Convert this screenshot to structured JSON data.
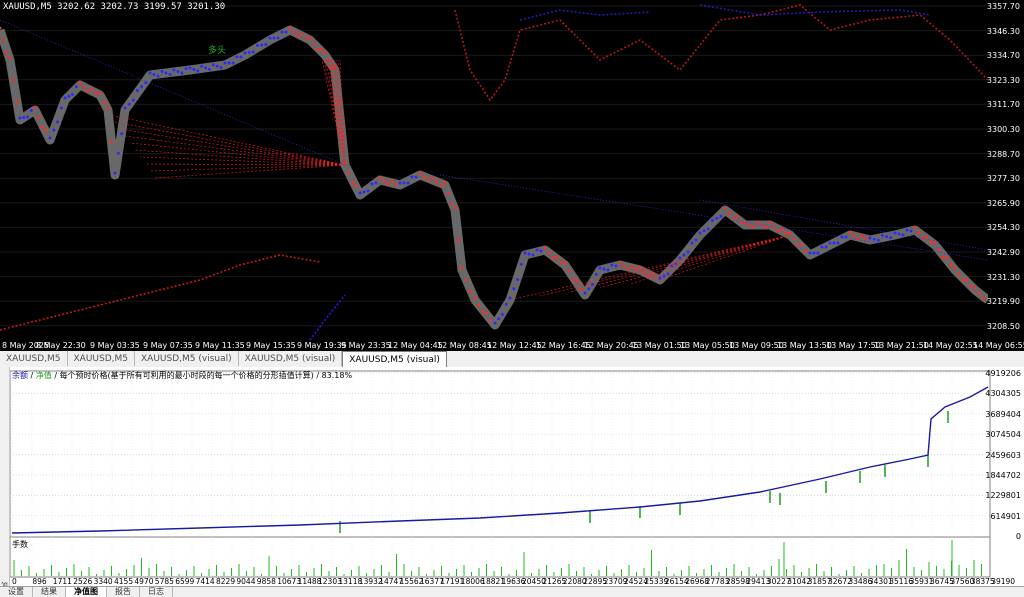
{
  "chart": {
    "symbol_label": "XAUUSD,M5  3202.62 3202.73 3199.57 3201.30",
    "annotation": "多头",
    "price_ticks": [
      "3357.70",
      "3346.30",
      "3334.70",
      "3323.30",
      "3311.70",
      "3300.30",
      "3288.70",
      "3277.30",
      "3265.90",
      "3254.30",
      "3242.90",
      "3231.30",
      "3219.90",
      "3208.50"
    ],
    "time_ticks": [
      "8 May 2025",
      "8 May 22:30",
      "9 May 03:35",
      "9 May 07:35",
      "9 May 11:35",
      "9 May 15:35",
      "9 May 19:35",
      "9 May 23:35",
      "12 May 04:45",
      "12 May 08:45",
      "12 May 12:45",
      "12 May 16:45",
      "12 May 20:45",
      "13 May 01:50",
      "13 May 05:50",
      "13 May 09:50",
      "13 May 13:50",
      "13 May 17:50",
      "13 May 21:50",
      "14 May 02:55",
      "14 May 06:55"
    ]
  },
  "tabs": [
    {
      "label": "XAUUSD,M5",
      "active": false
    },
    {
      "label": "XAUUSD,M5",
      "active": false
    },
    {
      "label": "XAUUSD,M5 (visual)",
      "active": false
    },
    {
      "label": "XAUUSD,M5 (visual)",
      "active": false
    },
    {
      "label": "XAUUSD,M5 (visual)",
      "active": true
    }
  ],
  "equity_graph": {
    "legend_balance": "余额",
    "legend_sep1": " / ",
    "legend_equity": "净值",
    "legend_sep2": " / ",
    "legend_text": "每个预时价格(基于所有可利用的最小时段的每一个价格的分形插值计算) / 83.18%",
    "y_ticks": [
      "4919206",
      "4304305",
      "3689404",
      "3074504",
      "2459603",
      "1844702",
      "1229801",
      "614901",
      "0"
    ],
    "volume_label": "手数",
    "x_ticks": [
      "0",
      "896",
      "1711",
      "2526",
      "3340",
      "4155",
      "4970",
      "5785",
      "6599",
      "7414",
      "8229",
      "9044",
      "9858",
      "10673",
      "11488",
      "12303",
      "13118",
      "13932",
      "14747",
      "15562",
      "16377",
      "17191",
      "18006",
      "18821",
      "19636",
      "20450",
      "21265",
      "22080",
      "22895",
      "23709",
      "24524",
      "25339",
      "26154",
      "26968",
      "27783",
      "28598",
      "29413",
      "30227",
      "31042",
      "31857",
      "32672",
      "33486",
      "34301",
      "35116",
      "35931",
      "36745",
      "37560",
      "38375",
      "39190"
    ],
    "colors": {
      "balance": "#1a1aa0",
      "equity": "#1c9e1c",
      "volume": "#22bb22"
    }
  },
  "bottom_tabs": [
    {
      "label": "设置",
      "active": false
    },
    {
      "label": "结果",
      "active": false
    },
    {
      "label": "净值图",
      "active": true
    },
    {
      "label": "报告",
      "active": false
    },
    {
      "label": "日志",
      "active": false
    }
  ],
  "side_label": "测试"
}
